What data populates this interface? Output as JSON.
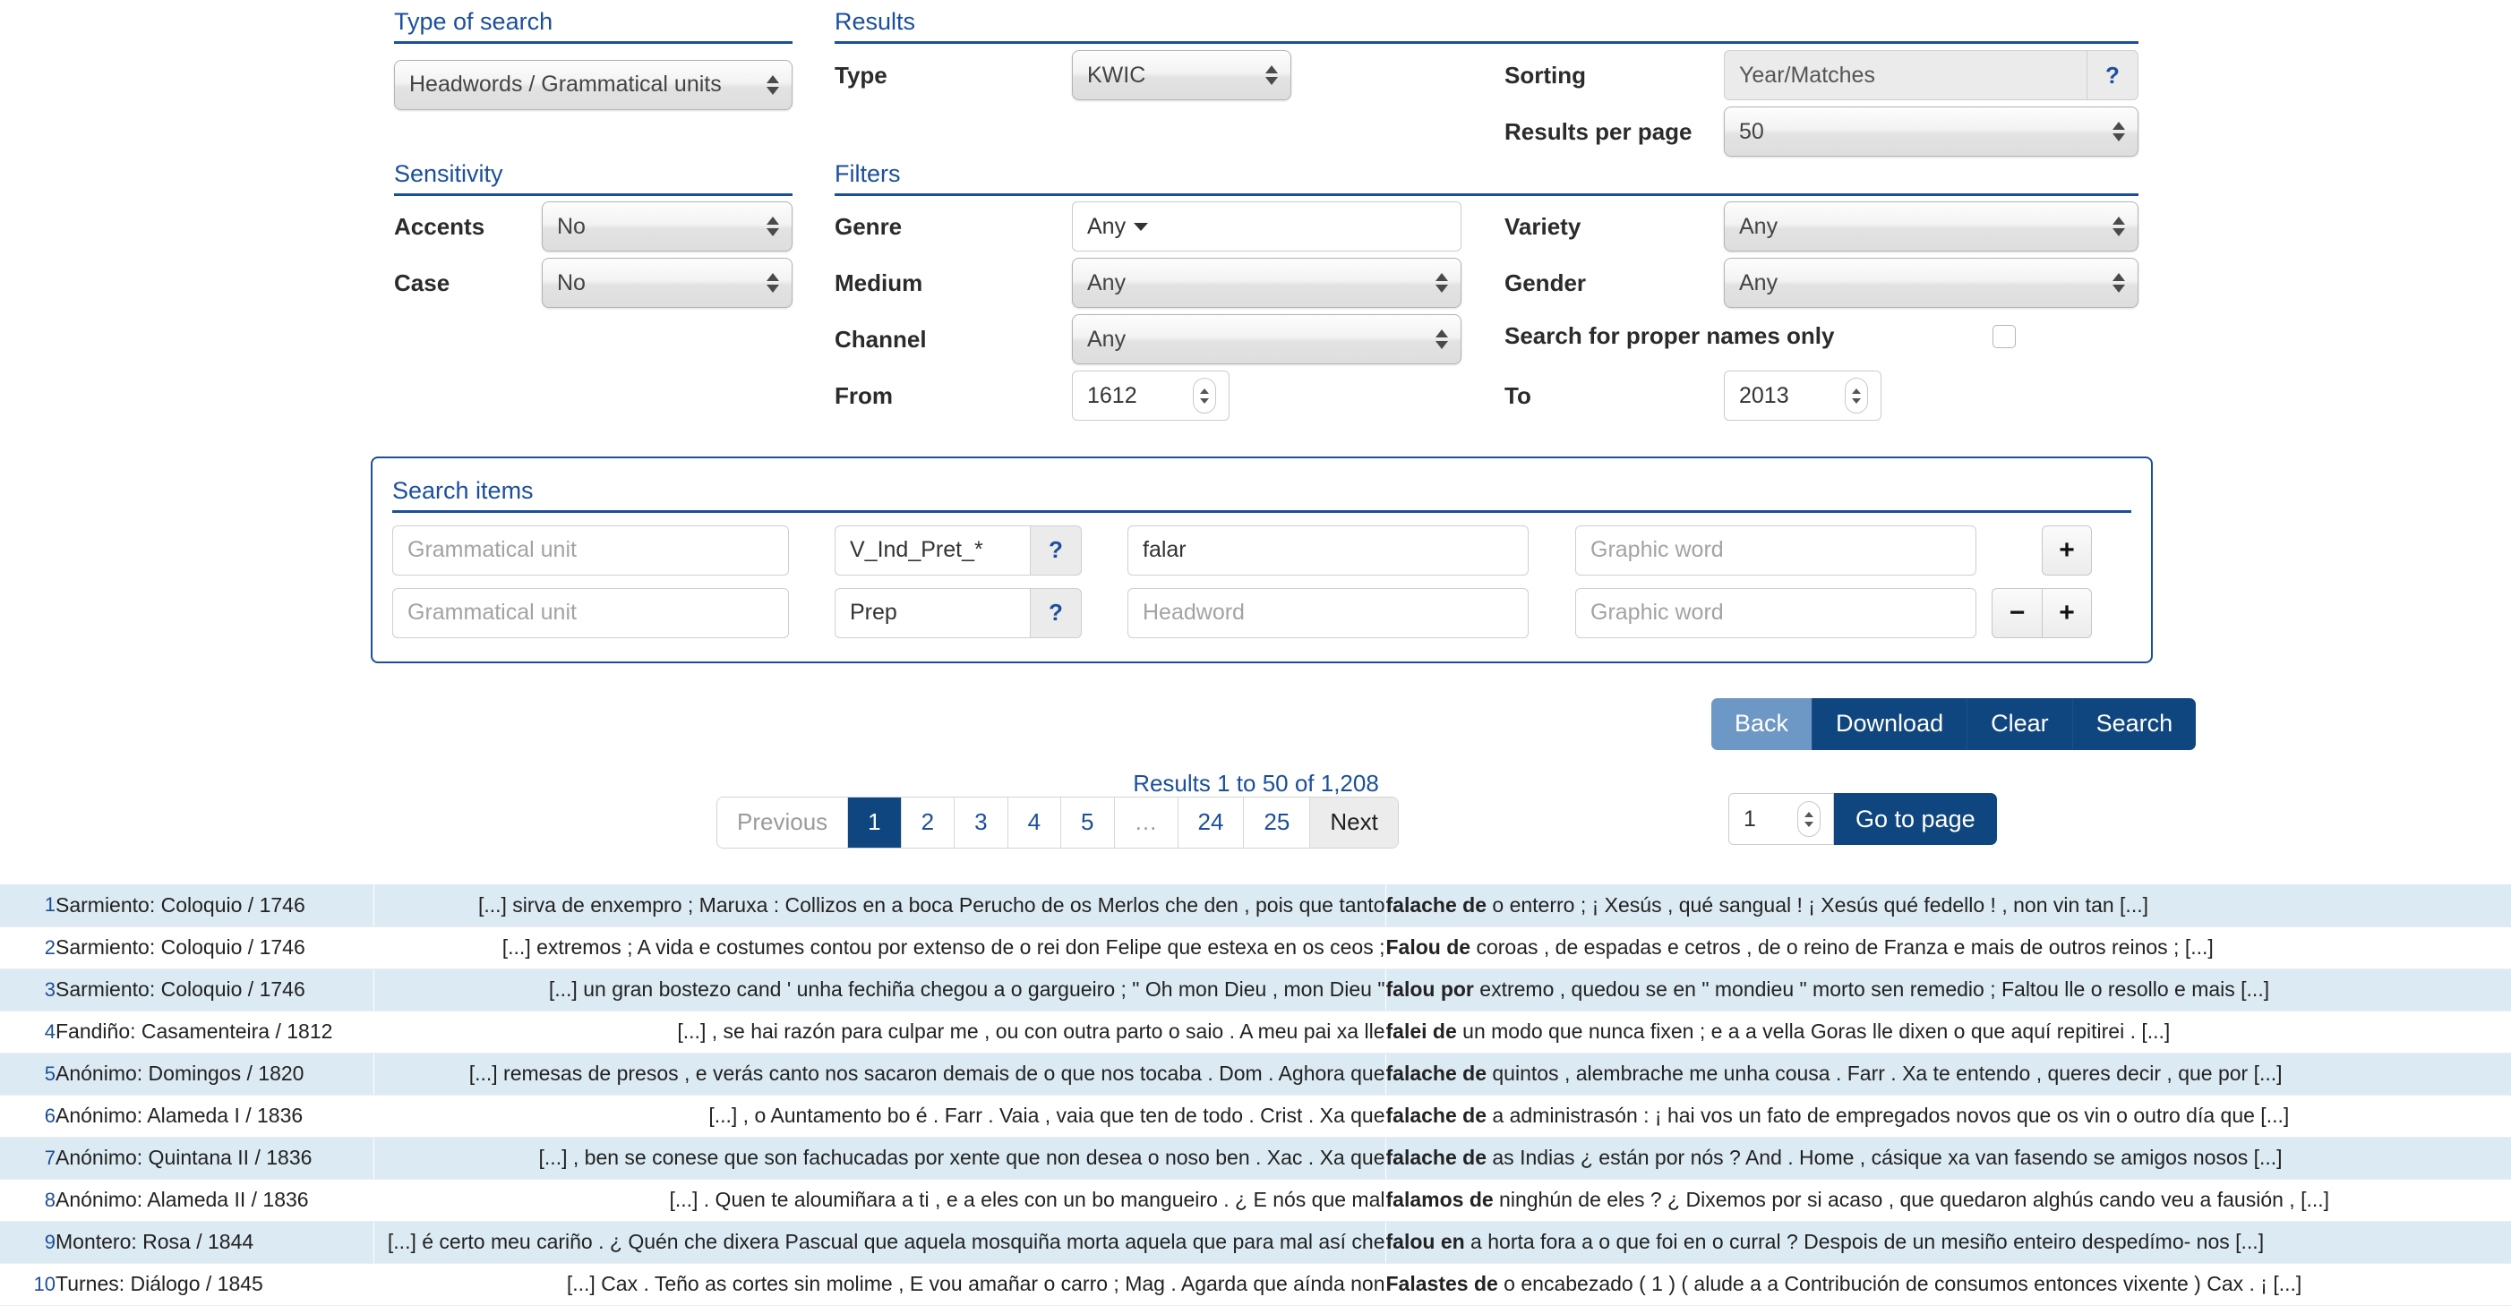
{
  "sections": {
    "type_of_search": {
      "legend": "Type of search",
      "value": "Headwords / Grammatical units"
    },
    "results": {
      "legend": "Results",
      "type_label": "Type",
      "type_value": "KWIC",
      "sorting_label": "Sorting",
      "sorting_value": "Year/Matches",
      "help_glyph": "?",
      "results_per_page_label": "Results per page",
      "results_per_page_value": "50"
    },
    "sensitivity": {
      "legend": "Sensitivity",
      "accents_label": "Accents",
      "accents_value": "No",
      "case_label": "Case",
      "case_value": "No"
    },
    "filters": {
      "legend": "Filters",
      "genre_label": "Genre",
      "genre_value": "Any",
      "medium_label": "Medium",
      "medium_value": "Any",
      "channel_label": "Channel",
      "channel_value": "Any",
      "from_label": "From",
      "from_value": "1612",
      "variety_label": "Variety",
      "variety_value": "Any",
      "gender_label": "Gender",
      "gender_value": "Any",
      "proper_names_label": "Search for proper names only",
      "to_label": "To",
      "to_value": "2013"
    },
    "search_items": {
      "legend": "Search items",
      "rows": [
        {
          "grammatical_unit_placeholder": "Grammatical unit",
          "tag_value": "V_Ind_Pret_*",
          "tag_help": "?",
          "headword_value": "falar",
          "headword_placeholder": "Headword",
          "graphic_word_placeholder": "Graphic word"
        },
        {
          "grammatical_unit_placeholder": "Grammatical unit",
          "tag_value": "Prep",
          "tag_help": "?",
          "headword_value": "",
          "headword_placeholder": "Headword",
          "graphic_word_placeholder": "Graphic word"
        }
      ],
      "add_row_glyph": "+",
      "remove_row_glyph": "−"
    }
  },
  "actions": {
    "back": "Back",
    "download": "Download",
    "clear": "Clear",
    "search": "Search"
  },
  "pagination": {
    "summary": "Results 1 to 50 of 1,208",
    "previous": "Previous",
    "next": "Next",
    "ellipsis": "…",
    "pages": [
      "1",
      "2",
      "3",
      "4",
      "5"
    ],
    "tail_pages": [
      "24",
      "25"
    ],
    "current": "1",
    "goto_value": "1",
    "goto_label": "Go to page"
  },
  "colors": {
    "accent_blue": "#1b4f9c",
    "button_blue": "#10467f",
    "button_active_blue": "#6d97c4",
    "row_stripe": "#dceaf3"
  },
  "results_table": {
    "rows": [
      {
        "n": "1",
        "ref": "Sarmiento: Coloquio / 1746",
        "left": "[...] sirva de enxempro ; Maruxa : Collizos en a boca Perucho de os Merlos che den , pois que tanto",
        "match": "falache de",
        "right": "o enterro ; ¡ Xesús , qué sangual ! ¡ Xesús qué fedello ! , non vin tan [...]"
      },
      {
        "n": "2",
        "ref": "Sarmiento: Coloquio / 1746",
        "left": "[...] extremos ; A vida e costumes contou por extenso de o rei don Felipe que estexa en os ceos ;",
        "match": "Falou de",
        "right": "coroas , de espadas e cetros , de o reino de Franza e mais de outros reinos ; [...]"
      },
      {
        "n": "3",
        "ref": "Sarmiento: Coloquio / 1746",
        "left": "[...] un gran bostezo cand ' unha fechiña chegou a o gargueiro ; \" Oh mon Dieu , mon Dieu \"",
        "match": "falou por",
        "right": "extremo , quedou se en \" mondieu \" morto sen remedio ; Faltou lle o resollo e mais [...]"
      },
      {
        "n": "4",
        "ref": "Fandiño: Casamenteira / 1812",
        "left": "[...] , se hai razón para culpar me , ou con outra parto o saio . A meu pai xa lle",
        "match": "falei de",
        "right": "un modo que nunca fixen ; e a a vella Goras lle dixen o que aquí repitirei . [...]"
      },
      {
        "n": "5",
        "ref": "Anónimo: Domingos / 1820",
        "left": "[...] remesas de presos , e verás canto nos sacaron demais de o que nos tocaba . Dom . Aghora que",
        "match": "falache de",
        "right": "quintos , alembrache me unha cousa . Farr . Xa te entendo , queres decir , que por [...]"
      },
      {
        "n": "6",
        "ref": "Anónimo: Alameda I / 1836",
        "left": "[...] , o Auntamento bo é . Farr . Vaia , vaia que ten de todo . Crist . Xa que",
        "match": "falache de",
        "right": "a administrasón : ¡ hai vos un fato de empregados novos que os vin o outro día que [...]"
      },
      {
        "n": "7",
        "ref": "Anónimo: Quintana II / 1836",
        "left": "[...] , ben se conese que son fachucadas por xente que non desea o noso ben . Xac . Xa que",
        "match": "falache de",
        "right": "as Indias ¿ están por nós ? And . Home , cásique xa van fasendo se amigos nosos [...]"
      },
      {
        "n": "8",
        "ref": "Anónimo: Alameda II / 1836",
        "left": "[...] . Quen te aloumiñara a ti , e a eles con un bo mangueiro . ¿ E nós que mal",
        "match": "falamos de",
        "right": "ninghún de eles ? ¿ Dixemos por si acaso , que quedaron alghús cando veu a fausión , [...]"
      },
      {
        "n": "9",
        "ref": "Montero: Rosa / 1844",
        "left": "[...] é certo meu cariño . ¿ Quén che dixera Pascual que aquela mosquiña morta aquela que para mal así che",
        "match": "falou en",
        "right": "a horta fora a o que foi en o curral ? Despois de un mesiño enteiro despedímo- nos [...]"
      },
      {
        "n": "10",
        "ref": "Turnes: Diálogo / 1845",
        "left": "[...] Cax . Teño as cortes sin molime , E vou amañar o carro ; Mag . Agarda que aínda non",
        "match": "Falastes de",
        "right": "o encabezado ( 1 ) ( alude a a Contribución de consumos entonces vixente ) Cax . ¡ [...]"
      }
    ]
  }
}
